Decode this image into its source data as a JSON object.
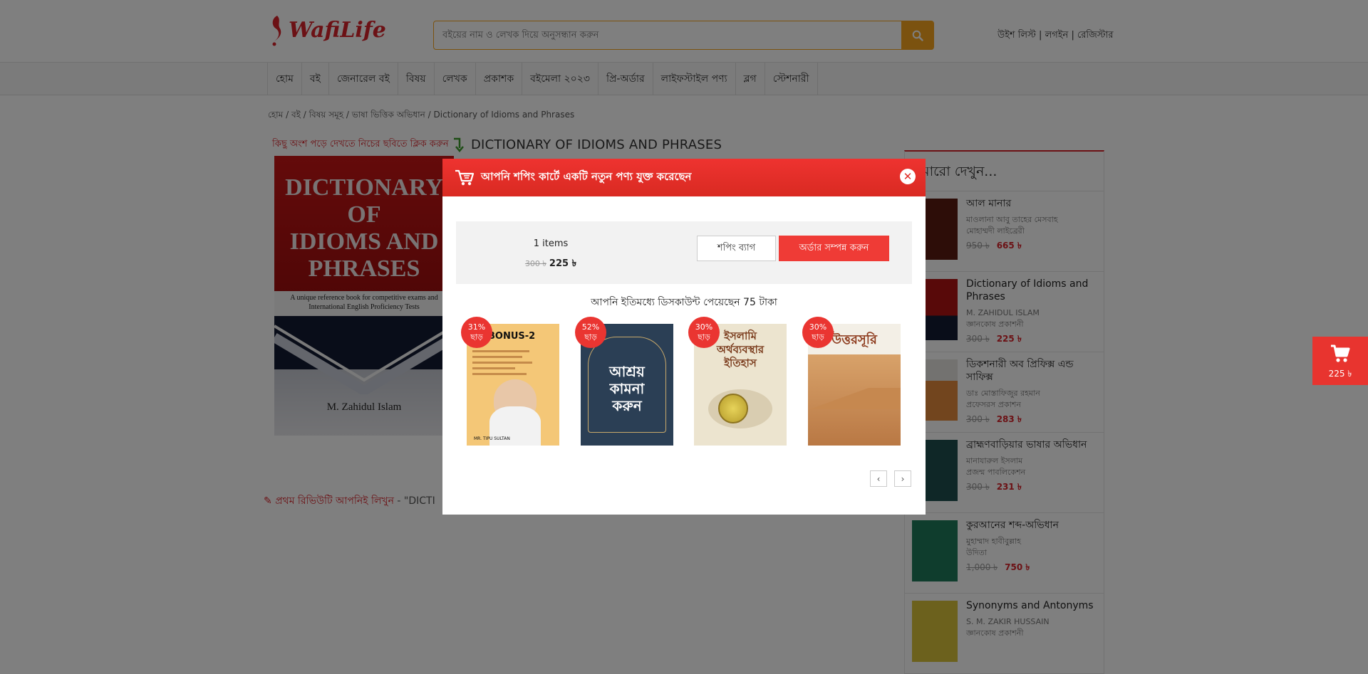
{
  "header": {
    "logo_text": "WafiLife",
    "search_placeholder": "বইয়ের নাম ও লেখক দিয়ে অনুসন্ধান করুন",
    "links": {
      "wishlist": "উইশ লিস্ট",
      "login": "লগইন",
      "register": "রেজিস্টার",
      "sep": " | "
    }
  },
  "nav": {
    "items": [
      "হোম",
      "বই",
      "জেনারেল বই",
      "বিষয়",
      "লেখক",
      "প্রকাশক",
      "বইমেলা ২০২৩",
      "প্রি-অর্ডার",
      "লাইফস্টাইল পণ্য",
      "ব্লগ",
      "স্টেশনারী"
    ]
  },
  "breadcrumb": "হোম / বই / বিষয় সমূহ / ভাষা ভিত্তিক অভিধান / Dictionary of Idioms and Phrases",
  "product": {
    "hint": "কিছু অংশ পড়ে দেখতে নিচের ছবিতে ক্লিক করুন",
    "title": "DICTIONARY OF IDIOMS AND PHRASES",
    "cover": {
      "title_lines": [
        "DICTIONARY",
        "OF",
        "IDIOMS AND",
        "PHRASES"
      ],
      "subtitle": "A unique reference book for competitive exams and International English Proficiency Tests",
      "author": "M. Zahidul Islam"
    },
    "review_link": "প্রথম রিভিউটি আপনিই লিখুন",
    "review_quote": " - \"DICTI"
  },
  "sidebar": {
    "heading": "আরো দেখুন...",
    "items": [
      {
        "title": "আল মানার",
        "author": "মাওলানা আবু তাহের মেসবাহ",
        "publisher": "মোহাম্মদী লাইব্রেরী",
        "old_price": "950 ৳",
        "new_price": "665 ৳",
        "color": "#5a1a10"
      },
      {
        "title": "Dictionary of Idioms and Phrases",
        "author": "M. ZAHIDUL ISLAM",
        "publisher": "জ্ঞানকোষ প্রকাশনী",
        "old_price": "300 ৳",
        "new_price": "225 ৳",
        "color": "#b01212"
      },
      {
        "title": "ডিকশনারী অব প্রিফিক্স এন্ড সাফিক্স",
        "author": "ডাঃ মোস্তাফিজুর রহমান",
        "publisher": "প্রফেসরস প্রকাশন",
        "old_price": "300 ৳",
        "new_price": "283 ৳",
        "color": "#e58a3c"
      },
      {
        "title": "ব্রাহ্মণবাড়িয়ার ভাষার অভিধান",
        "author": "মানাযারুল ইসলাম",
        "publisher": "প্রজন্ম পাবলিকেশন",
        "old_price": "300 ৳",
        "new_price": "231 ৳",
        "color": "#1f4f4f"
      },
      {
        "title": "কুরআনের শব্দ-অভিধান",
        "author": "মুহাম্মাদ হাবীবুল্লাহ",
        "publisher": "উদিতা",
        "old_price": "1,000 ৳",
        "new_price": "750 ৳",
        "color": "#1e7a5a"
      },
      {
        "title": "Synonyms and Antonyms",
        "author": "S. M. ZAKIR HUSSAIN",
        "publisher": "জ্ঞানকোষ প্রকাশনী",
        "old_price": "",
        "new_price": "",
        "color": "#d9c23a"
      }
    ]
  },
  "floating_cart": {
    "price": "225 ৳"
  },
  "modal": {
    "title": "আপনি শপিং কার্টে একটি নতুন পণ্য যুক্ত করেছেন",
    "items_count": "1 items",
    "old_price": "300 ৳",
    "new_price": "225 ৳",
    "bag_button": "শপিং ব্যাগ",
    "order_button": "অর্ডার সম্পন্ন করুন",
    "discount_message": "আপনি ইতিমধ্যে ডিসকাউন্ট পেয়েছেন 75 টাকা",
    "books": [
      {
        "discount": "31%",
        "off_label": "ছাড়",
        "cover_text": "BONUS-2",
        "cover_sub": "MR. TIPU SULTAN",
        "bg": "#f4c777"
      },
      {
        "discount": "52%",
        "off_label": "ছাড়",
        "cover_text": "আশ্রয় কামনা করুন",
        "cover_sub": "",
        "bg": "#2b3f55"
      },
      {
        "discount": "30%",
        "off_label": "ছাড়",
        "cover_text": "ইসলামি অর্থব্যবস্থার ইতিহাস",
        "cover_sub": "",
        "bg": "#ece4cf"
      },
      {
        "discount": "30%",
        "off_label": "ছাড়",
        "cover_text": "উত্তরসূরি",
        "cover_sub": "",
        "bg": "#d8a26a"
      }
    ]
  }
}
